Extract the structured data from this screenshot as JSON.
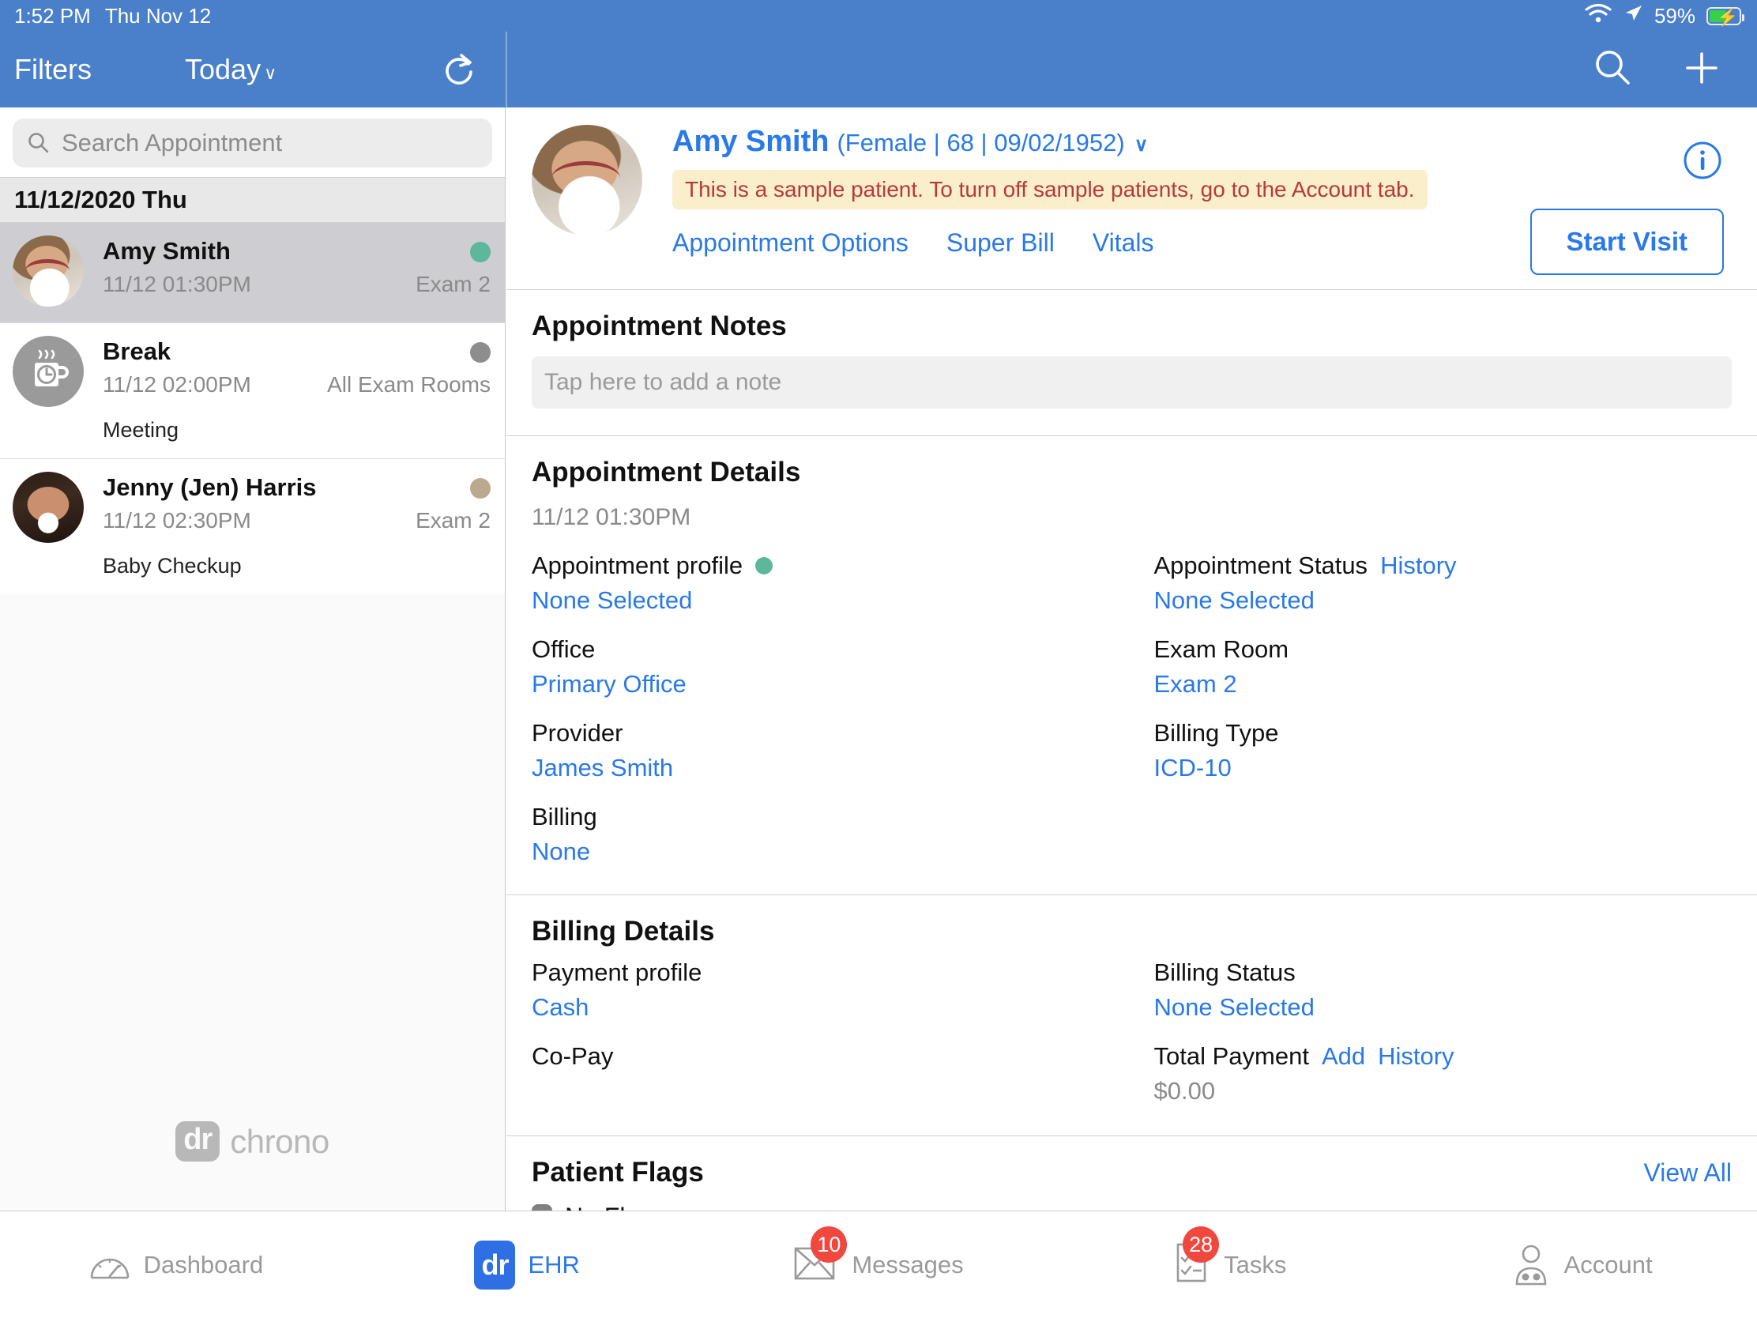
{
  "status_bar": {
    "time": "1:52 PM",
    "date": "Thu Nov 12",
    "battery_percent": "59%",
    "wifi_icon": "wifi-icon",
    "location_icon": "location-arrow-icon",
    "battery_icon": "battery-charging-icon"
  },
  "nav_bar": {
    "filters_label": "Filters",
    "today_label": "Today",
    "chevron": "∨",
    "refresh_icon": "refresh-icon",
    "search_icon": "search-icon",
    "add_icon": "plus-icon",
    "background_color": "#4a7fc9"
  },
  "sidebar": {
    "search": {
      "placeholder": "Search Appointment",
      "value": "",
      "icon": "search-icon"
    },
    "date_header": "11/12/2020 Thu",
    "appointments": [
      {
        "name": "Amy Smith",
        "time": "11/12 01:30PM",
        "room": "Exam 2",
        "subtitle": "",
        "status_color": "#5cb79b",
        "selected": true,
        "avatar_type": "photo-amy"
      },
      {
        "name": "Break",
        "time": "11/12 02:00PM",
        "room": "All Exam Rooms",
        "subtitle": "Meeting",
        "status_color": "#8d8d8d",
        "selected": false,
        "avatar_type": "break-coffee-icon"
      },
      {
        "name": "Jenny (Jen) Harris",
        "time": "11/12 02:30PM",
        "room": "Exam 2",
        "subtitle": "Baby Checkup",
        "status_color": "#bba98f",
        "selected": false,
        "avatar_type": "photo-jenny"
      }
    ],
    "logo": {
      "badge": "dr",
      "text": "chrono"
    }
  },
  "patient_header": {
    "name": "Amy Smith",
    "demographics": "(Female | 68 | 09/02/1952)",
    "chevron": "∨",
    "sample_banner": "This is a sample patient. To turn off sample patients, go to the Account tab.",
    "links": [
      "Appointment Options",
      "Super Bill",
      "Vitals"
    ],
    "info_icon": "info-circle-icon",
    "start_visit_label": "Start Visit",
    "accent_color": "#2979e8",
    "banner_bg": "#faeecb",
    "banner_text_color": "#b63a3a"
  },
  "appointment_notes": {
    "title": "Appointment Notes",
    "placeholder": "Tap here to add a note",
    "value": ""
  },
  "appointment_details": {
    "title": "Appointment Details",
    "datetime": "11/12 01:30PM",
    "left_fields": [
      {
        "label": "Appointment profile",
        "value": "None Selected",
        "dot_color": "#5cb79b"
      },
      {
        "label": "Office",
        "value": "Primary Office"
      },
      {
        "label": "Provider",
        "value": "James Smith"
      },
      {
        "label": "Billing",
        "value": "None"
      }
    ],
    "right_fields": [
      {
        "label": "Appointment Status",
        "link": "History",
        "value": "None Selected"
      },
      {
        "label": "Exam Room",
        "value": "Exam 2"
      },
      {
        "label": "Billing Type",
        "value": "ICD-10"
      }
    ]
  },
  "billing_details": {
    "title": "Billing Details",
    "left_fields": [
      {
        "label": "Payment profile",
        "value": "Cash"
      },
      {
        "label": "Co-Pay",
        "value": ""
      }
    ],
    "right_fields": [
      {
        "label": "Billing Status",
        "value": "None Selected"
      },
      {
        "label": "Total Payment",
        "links": [
          "Add",
          "History"
        ],
        "value": "$0.00"
      }
    ]
  },
  "patient_flags": {
    "title": "Patient Flags",
    "view_all": "View All",
    "flag_text": "No Flags",
    "flag_color": "#808080"
  },
  "tab_bar": {
    "tabs": [
      {
        "label": "Dashboard",
        "icon": "gauge-icon",
        "badge": "",
        "active": false
      },
      {
        "label": "EHR",
        "icon": "dr-logo-icon",
        "badge": "",
        "active": true
      },
      {
        "label": "Messages",
        "icon": "envelope-icon",
        "badge": "10",
        "active": false
      },
      {
        "label": "Tasks",
        "icon": "checklist-icon",
        "badge": "28",
        "active": false
      },
      {
        "label": "Account",
        "icon": "user-stethoscope-icon",
        "badge": "",
        "active": false
      }
    ],
    "badge_color": "#f0483e"
  }
}
